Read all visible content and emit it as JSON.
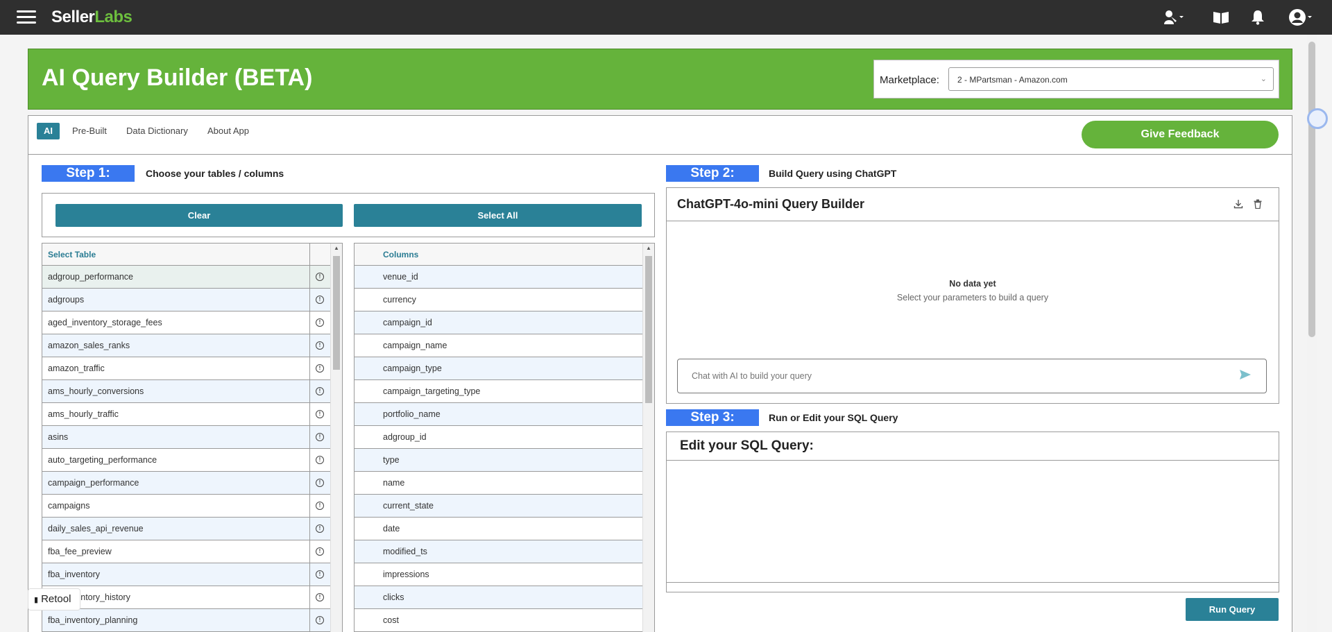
{
  "topbar": {
    "logo_part1": "Seller",
    "logo_part2": "Labs",
    "icons": [
      "menu-icon",
      "support-icon",
      "book-icon",
      "bell-icon",
      "user-icon"
    ]
  },
  "header": {
    "title": "AI Query Builder (BETA)",
    "marketplace_label": "Marketplace:",
    "marketplace_value": "2 - MPartsman - Amazon.com",
    "brand_color": "#65b33b"
  },
  "tabs": [
    {
      "label": "AI",
      "active": true
    },
    {
      "label": "Pre-Built",
      "active": false
    },
    {
      "label": "Data Dictionary",
      "active": false
    },
    {
      "label": "About App",
      "active": false
    }
  ],
  "feedback_label": "Give Feedback",
  "step1": {
    "badge": "Step 1:",
    "text": "Choose your tables / columns",
    "clear_label": "Clear",
    "select_all_label": "Select All",
    "table_header": "Select Table",
    "tables": [
      "adgroup_performance",
      "adgroups",
      "aged_inventory_storage_fees",
      "amazon_sales_ranks",
      "amazon_traffic",
      "ams_hourly_conversions",
      "ams_hourly_traffic",
      "asins",
      "auto_targeting_performance",
      "campaign_performance",
      "campaigns",
      "daily_sales_api_revenue",
      "fba_fee_preview",
      "fba_inventory",
      "fba_inventory_history",
      "fba_inventory_planning"
    ],
    "columns_header": "Columns",
    "columns": [
      "venue_id",
      "currency",
      "campaign_id",
      "campaign_name",
      "campaign_type",
      "campaign_targeting_type",
      "portfolio_name",
      "adgroup_id",
      "type",
      "name",
      "current_state",
      "date",
      "modified_ts",
      "impressions",
      "clicks",
      "cost"
    ]
  },
  "step2": {
    "badge": "Step 2:",
    "text": "Build Query using ChatGPT",
    "title": "ChatGPT-4o-mini Query Builder",
    "empty_title": "No data yet",
    "empty_sub": "Select your parameters to build a query",
    "chat_placeholder": "Chat with AI to build your query"
  },
  "step3": {
    "badge": "Step 3:",
    "text": "Run or Edit your SQL Query",
    "sql_title": "Edit your SQL Query:",
    "run_label": "Run Query"
  },
  "retool_label": "Retool",
  "accent_color": "#2a8197",
  "step_color": "#3a78f0"
}
